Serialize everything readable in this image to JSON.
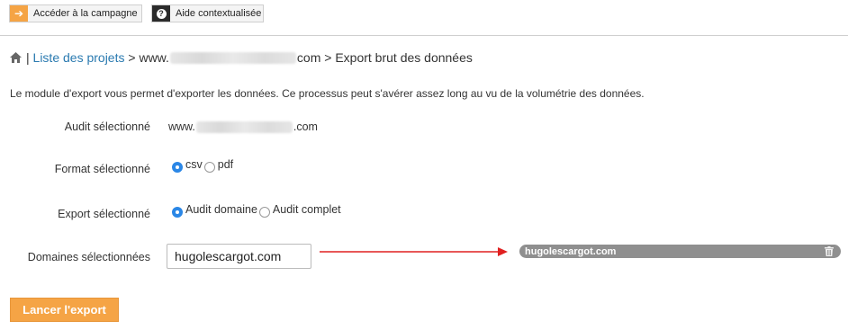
{
  "topbar": {
    "campaign_label": "Accéder à la campagne",
    "campaign_icon": "arrow-right-icon",
    "help_label": "Aide contextualisée",
    "help_icon": "question-icon"
  },
  "breadcrumb": {
    "home_icon": "home-icon",
    "separator": "|",
    "projects_link": "Liste des projets",
    "arrow1": ">",
    "site_prefix": "www.",
    "site_suffix": "com",
    "arrow2": ">",
    "current": "Export brut des données"
  },
  "intro": "Le module d'export vous permet d'exporter les données. Ce processus peut s'avérer assez long au vu de la volumétrie des données.",
  "form": {
    "audit": {
      "label": "Audit sélectionné",
      "value_prefix": "www.",
      "value_suffix": ".com"
    },
    "format": {
      "label": "Format sélectionné",
      "options": [
        {
          "label": "csv",
          "checked": true
        },
        {
          "label": "pdf",
          "checked": false
        }
      ]
    },
    "export": {
      "label": "Export sélectionné",
      "options": [
        {
          "label": "Audit domaine",
          "checked": true
        },
        {
          "label": "Audit complet",
          "checked": false
        }
      ]
    },
    "domains": {
      "label": "Domaines sélectionnées",
      "input_value": "hugolescargot.com",
      "selected_tag": "hugolescargot.com",
      "tag_icon": "trash-icon"
    }
  },
  "submit_label": "Lancer l'export",
  "colors": {
    "accent": "#f5a445",
    "link": "#2a7ab0",
    "radio": "#2b87e6",
    "arrow": "#e02020",
    "tag": "#8f8f8f"
  }
}
